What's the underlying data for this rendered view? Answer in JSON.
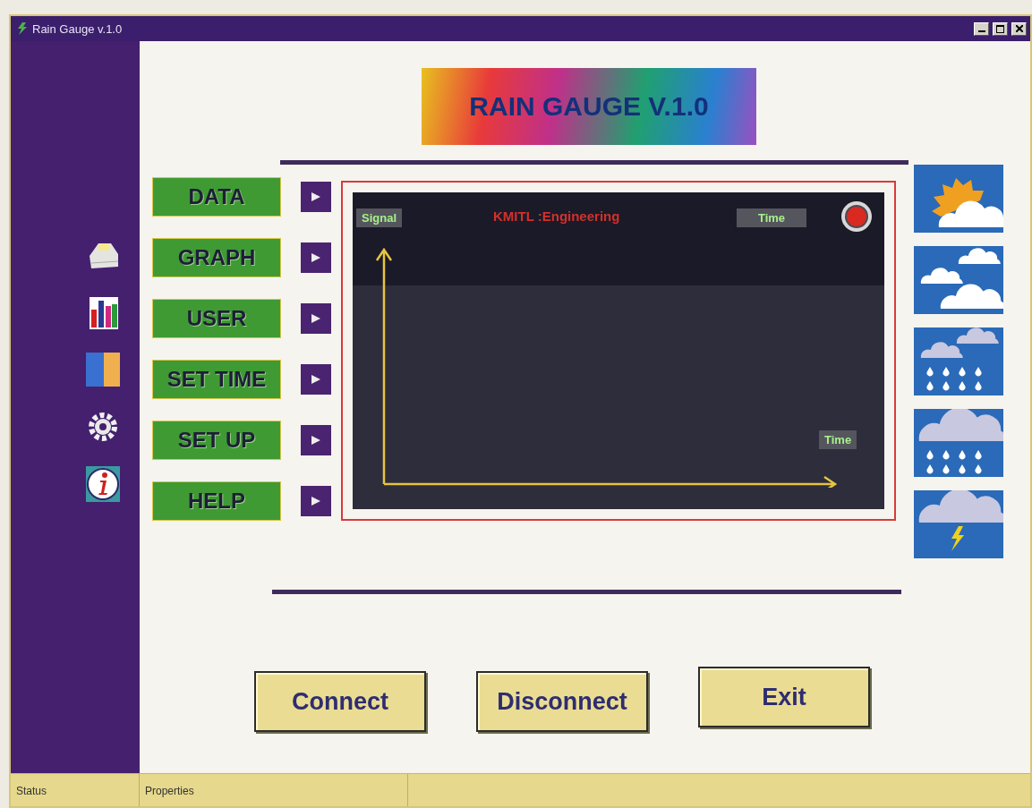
{
  "window": {
    "title": "Rain Gauge v.1.0"
  },
  "banner": {
    "title": "RAIN GAUGE V.1.0"
  },
  "menu": [
    {
      "label": "DATA"
    },
    {
      "label": "GRAPH"
    },
    {
      "label": "USER"
    },
    {
      "label": "SET TIME"
    },
    {
      "label": "SET UP"
    },
    {
      "label": "HELP"
    }
  ],
  "graph": {
    "title": "KMITL :Engineering",
    "y_label": "Signal",
    "top_right_label": "Time",
    "x_label": "Time"
  },
  "buttons": [
    "Connect",
    "Disconnect",
    "Exit"
  ],
  "status_bar": [
    "Status",
    "Properties"
  ]
}
